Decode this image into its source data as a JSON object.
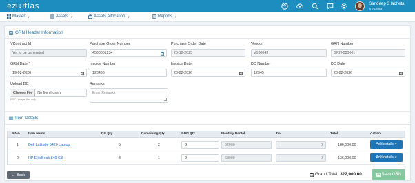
{
  "app": {
    "logo": "ez⩊tlas"
  },
  "user": {
    "name": "Sandeep 3 lacheta",
    "role": "IT ADMIN"
  },
  "menu": [
    {
      "label": "Master",
      "icon": "grid-icon"
    },
    {
      "label": "Assets",
      "icon": "list-icon"
    },
    {
      "label": "Assets Allocation",
      "icon": "bag-icon"
    },
    {
      "label": "Reports",
      "icon": "report-icon"
    }
  ],
  "header_section": {
    "title": "GRN Header Information",
    "fields": {
      "vcontract_label": "VContract Id",
      "vcontract_value": "Yet to be generated",
      "po_number_label": "Purchase Order Number",
      "po_number_value": "4500001234",
      "po_date_label": "Purchase Order Date",
      "po_date_value": "20-12-2025",
      "vendor_label": "Vendor",
      "vendor_value": "V100043",
      "grn_number_label": "GRN Number",
      "grn_number_value": "GRN-000001",
      "grn_date_label": "GRN Date",
      "grn_date_required": "*",
      "grn_date_value": "19-02-2026",
      "invoice_number_label": "Invoice Number",
      "invoice_number_value": "123456",
      "invoice_date_label": "Invoice Date",
      "invoice_date_value": "20-02-2026",
      "dc_number_label": "DC Number",
      "dc_number_value": "12345",
      "dc_date_label": "DC Date",
      "dc_date_value": "20-02-2026",
      "upload_dc_label": "Upload DC",
      "choose_file_label": "Choose File",
      "no_file_label": "No file chosen",
      "upload_hint": "PDF / Image files only",
      "remarks_label": "Remarks",
      "remarks_placeholder": "Enter Remarks"
    }
  },
  "items_section": {
    "title": "Item Details",
    "columns": [
      "S.No.",
      "Item Name",
      "PO Qty",
      "Remaining Qty",
      "GRN Qty",
      "Monthly Rental",
      "Tax",
      "Total",
      "Action"
    ],
    "rows": [
      {
        "sno": "1",
        "item": "Dell Latitude 5420 Laptop",
        "po_qty": "5",
        "remaining_qty": "2",
        "grn_qty": "3",
        "rental": "62000",
        "tax": "0",
        "total": "186,000.00",
        "action": "Add details"
      },
      {
        "sno": "2",
        "item": "HP EliteBook 840 G8",
        "po_qty": "3",
        "remaining_qty": "1",
        "grn_qty": "2",
        "rental": "68000",
        "tax": "0",
        "total": "136,000.00",
        "action": "Add details"
      }
    ]
  },
  "footer": {
    "back_label": "Back",
    "grand_total_label": "Grand Total:",
    "grand_total_value": "322,000.00",
    "save_label": "Save GRN"
  },
  "colors": {
    "primary": "#1d8dc0",
    "button": "#1d75b8",
    "save": "#86c9a0",
    "back": "#5f6a75"
  }
}
